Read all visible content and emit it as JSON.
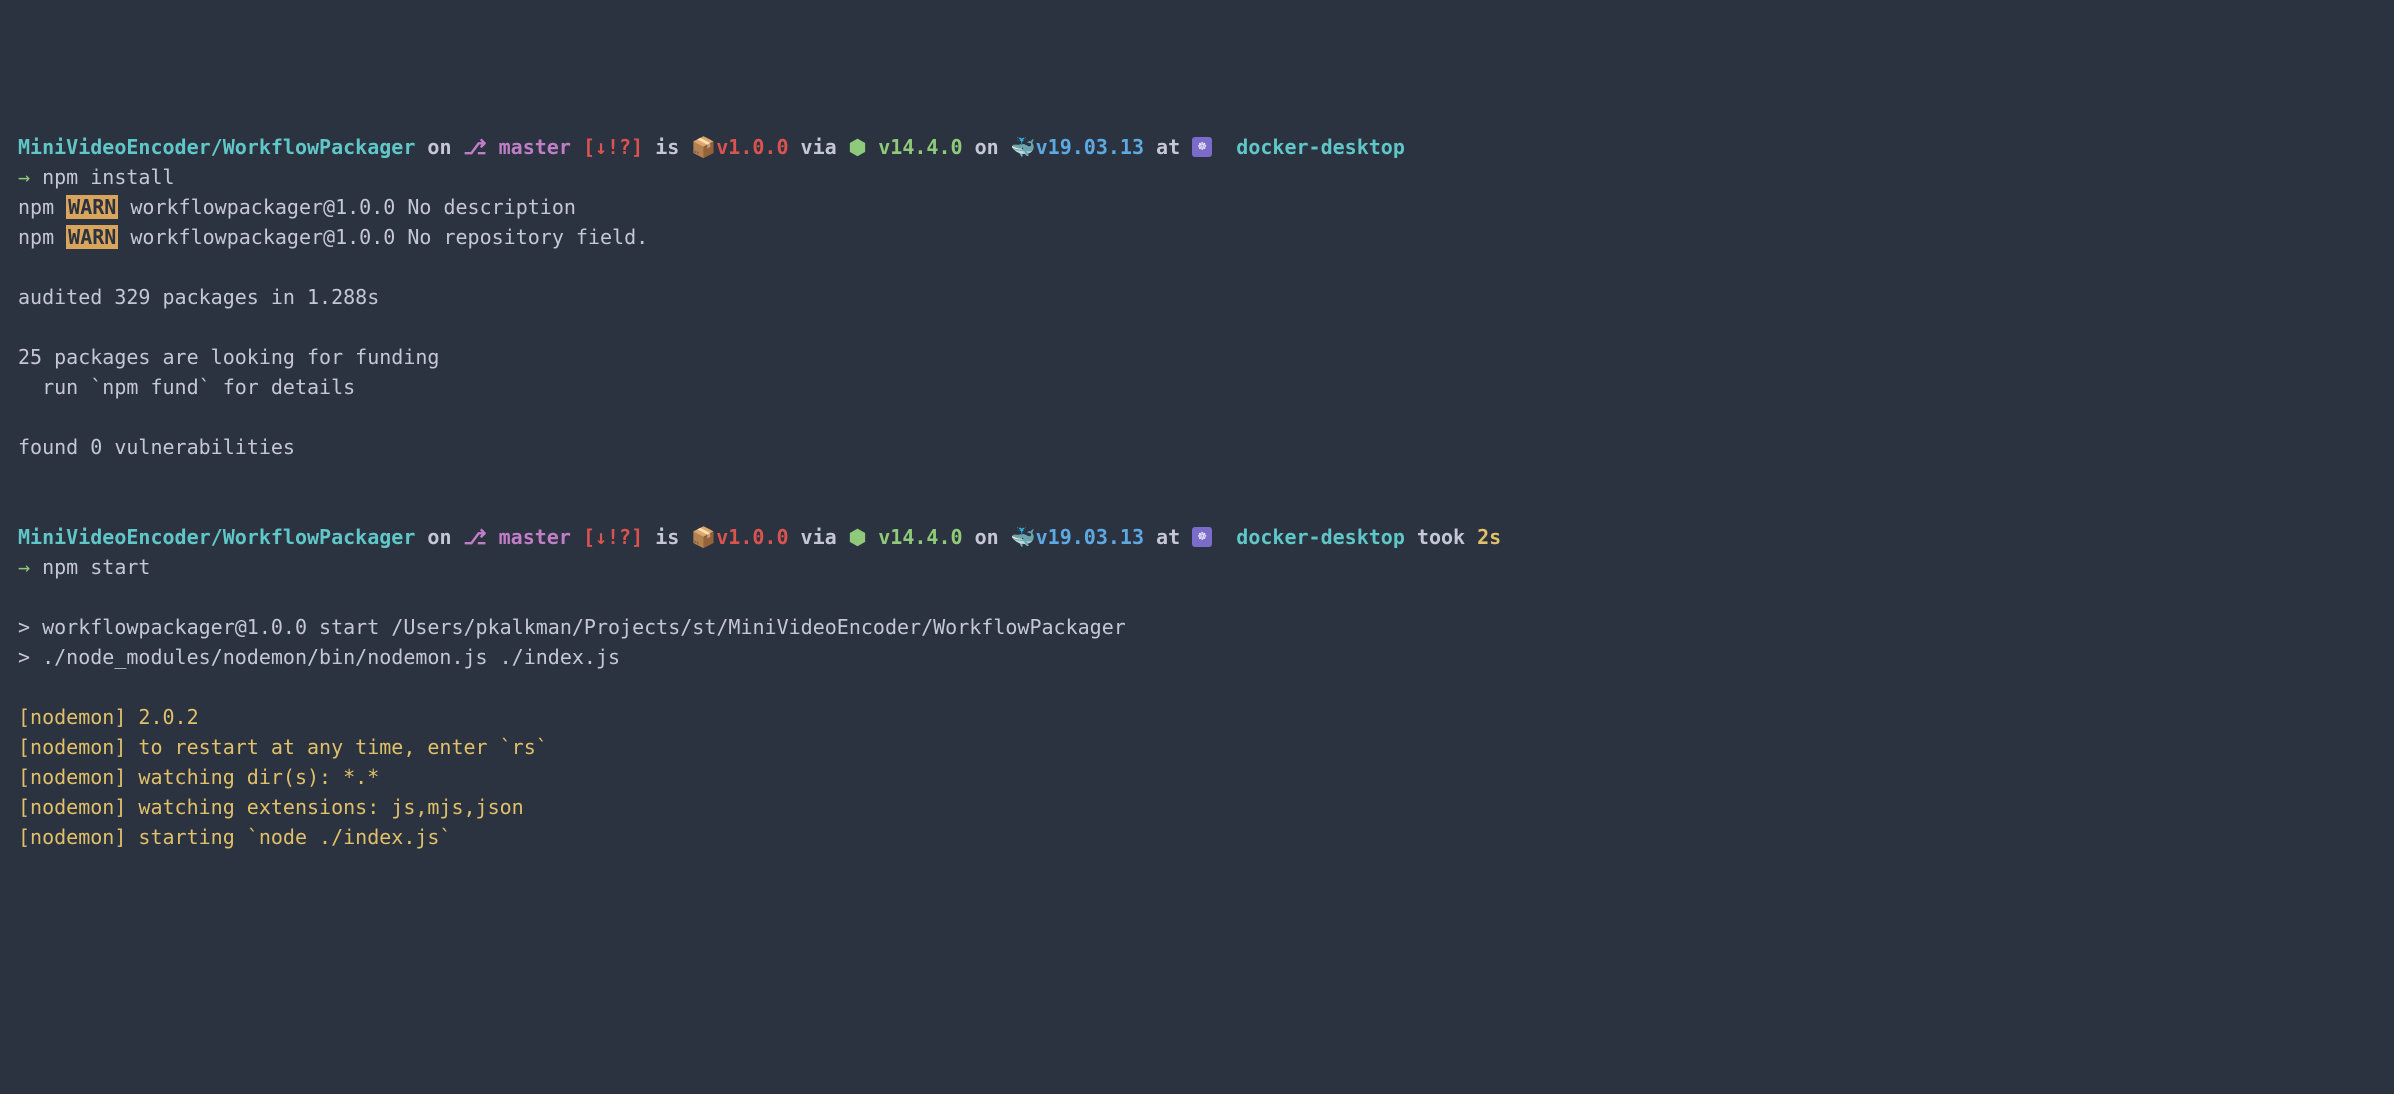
{
  "prompt1": {
    "path": "MiniVideoEncoder/WorkflowPackager",
    "on": "on",
    "branch_icon": "⎇",
    "branch": "master",
    "git_status": "[↓!?]",
    "is": "is",
    "pkg_emoji": "📦",
    "pkg_version": "v1.0.0",
    "via": "via",
    "node_emoji": "⬢",
    "node_version": "v14.4.0",
    "on2": "on",
    "docker_emoji": "🐳",
    "docker_version": "v19.03.13",
    "at": "at",
    "k8s_emoji": "☸",
    "k8s_context": "docker-desktop"
  },
  "cmd1": {
    "arrow": "→",
    "text": "npm install"
  },
  "warn1": {
    "prefix": "npm",
    "badge": "WARN",
    "text": " workflowpackager@1.0.0 No description"
  },
  "warn2": {
    "prefix": "npm",
    "badge": "WARN",
    "text": " workflowpackager@1.0.0 No repository field."
  },
  "audit": "audited 329 packages in 1.288s",
  "funding1": "25 packages are looking for funding",
  "funding2": "  run `npm fund` for details",
  "vuln": "found 0 vulnerabilities",
  "prompt2": {
    "path": "MiniVideoEncoder/WorkflowPackager",
    "on": "on",
    "branch_icon": "⎇",
    "branch": "master",
    "git_status": "[↓!?]",
    "is": "is",
    "pkg_emoji": "📦",
    "pkg_version": "v1.0.0",
    "via": "via",
    "node_emoji": "⬢",
    "node_version": "v14.4.0",
    "on2": "on",
    "docker_emoji": "🐳",
    "docker_version": "v19.03.13",
    "at": "at",
    "k8s_emoji": "☸",
    "k8s_context": "docker-desktop",
    "took": "took",
    "duration": "2s"
  },
  "cmd2": {
    "arrow": "→",
    "text": "npm start"
  },
  "start1": "> workflowpackager@1.0.0 start /Users/pkalkman/Projects/st/MiniVideoEncoder/WorkflowPackager",
  "start2": "> ./node_modules/nodemon/bin/nodemon.js ./index.js",
  "nodemon1": "[nodemon] 2.0.2",
  "nodemon2": "[nodemon] to restart at any time, enter `rs`",
  "nodemon3": "[nodemon] watching dir(s): *.*",
  "nodemon4": "[nodemon] watching extensions: js,mjs,json",
  "nodemon5": "[nodemon] starting `node ./index.js`"
}
